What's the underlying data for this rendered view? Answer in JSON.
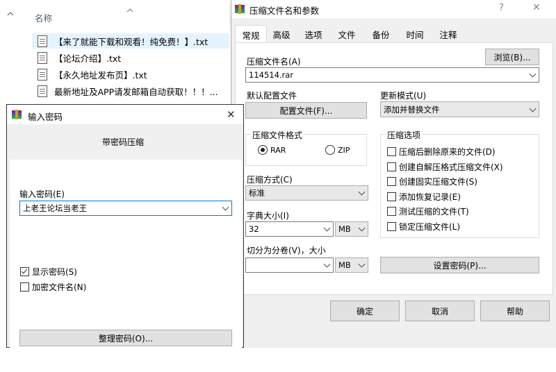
{
  "explorer": {
    "column_header": "名称",
    "files": [
      "【来了就能下载和观看！纯免费！】.txt",
      "【论坛介绍】.txt",
      "【永久地址发布页】.txt",
      "最新地址及APP请发邮箱自动获取！！！..."
    ]
  },
  "main_dialog": {
    "title": "压缩文件名和参数",
    "help": "?",
    "close": "✕",
    "tabs": [
      "常规",
      "高级",
      "选项",
      "文件",
      "备份",
      "时间",
      "注释"
    ],
    "archive_name_label": "压缩文件名(A)",
    "browse_button": "浏览(B)...",
    "archive_name_value": "114514.rar",
    "default_profile_label": "默认配置文件",
    "profile_button": "配置文件(F)...",
    "update_mode_label": "更新模式(U)",
    "update_mode_value": "添加并替换文件",
    "format_group_label": "压缩文件格式",
    "format_rar": "RAR",
    "format_zip": "ZIP",
    "options_group_label": "压缩选项",
    "options": [
      {
        "label": "压缩后删除原来的文件(D)",
        "checked": false
      },
      {
        "label": "创建自解压格式压缩文件(X)",
        "checked": false
      },
      {
        "label": "创建固实压缩文件(S)",
        "checked": false
      },
      {
        "label": "添加恢复记录(E)",
        "checked": false
      },
      {
        "label": "测试压缩的文件(T)",
        "checked": false
      },
      {
        "label": "锁定压缩文件(L)",
        "checked": false
      }
    ],
    "method_label": "压缩方式(C)",
    "method_value": "标准",
    "dict_label": "字典大小(I)",
    "dict_value": "32",
    "dict_unit": "MB",
    "split_label": "切分为分卷(V)，大小",
    "split_value": "",
    "split_unit": "MB",
    "set_password_button": "设置密码(P)...",
    "ok_button": "确定",
    "cancel_button": "取消",
    "help_button": "帮助"
  },
  "password_dialog": {
    "title": "输入密码",
    "close": "✕",
    "heading": "带密码压缩",
    "input_label": "输入密码(E)",
    "input_value": "上老王论坛当老王",
    "show_password": {
      "label": "显示密码(S)",
      "checked": true
    },
    "encrypt_names": {
      "label": "加密文件名(N)",
      "checked": false
    },
    "organize_button": "整理密码(O)..."
  }
}
